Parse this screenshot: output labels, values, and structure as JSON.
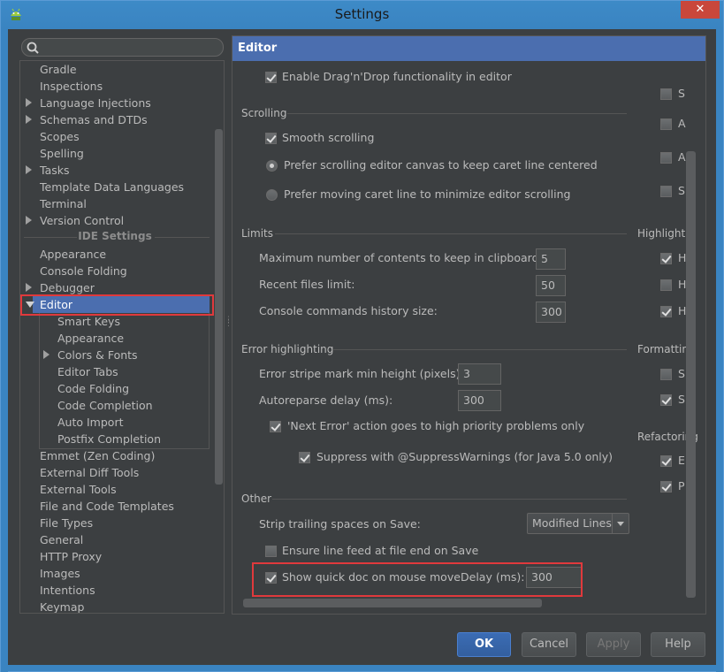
{
  "window": {
    "title": "Settings",
    "close_glyph": "✕"
  },
  "search": {
    "placeholder": ""
  },
  "tree": {
    "items_top": [
      {
        "label": "Gradle",
        "arrow": false
      },
      {
        "label": "Inspections",
        "arrow": false
      },
      {
        "label": "Language Injections",
        "arrow": true
      },
      {
        "label": "Schemas and DTDs",
        "arrow": true
      },
      {
        "label": "Scopes",
        "arrow": false
      },
      {
        "label": "Spelling",
        "arrow": false
      },
      {
        "label": "Tasks",
        "arrow": true
      },
      {
        "label": "Template Data Languages",
        "arrow": false
      },
      {
        "label": "Terminal",
        "arrow": false
      },
      {
        "label": "Version Control",
        "arrow": true
      }
    ],
    "section_label": "IDE Settings",
    "items_ide": [
      {
        "label": "Appearance",
        "arrow": false
      },
      {
        "label": "Console Folding",
        "arrow": false
      },
      {
        "label": "Debugger",
        "arrow": true
      }
    ],
    "selected": "Editor",
    "editor_children": [
      {
        "label": "Smart Keys",
        "arrow": false
      },
      {
        "label": "Appearance",
        "arrow": false
      },
      {
        "label": "Colors & Fonts",
        "arrow": true
      },
      {
        "label": "Editor Tabs",
        "arrow": false
      },
      {
        "label": "Code Folding",
        "arrow": false
      },
      {
        "label": "Code Completion",
        "arrow": false
      },
      {
        "label": "Auto Import",
        "arrow": false
      },
      {
        "label": "Postfix Completion",
        "arrow": false
      }
    ],
    "items_bottom": [
      {
        "label": "Emmet (Zen Coding)",
        "arrow": false
      },
      {
        "label": "External Diff Tools",
        "arrow": false
      },
      {
        "label": "External Tools",
        "arrow": false
      },
      {
        "label": "File and Code Templates",
        "arrow": false
      },
      {
        "label": "File Types",
        "arrow": false
      },
      {
        "label": "General",
        "arrow": false
      },
      {
        "label": "HTTP Proxy",
        "arrow": false
      },
      {
        "label": "Images",
        "arrow": false
      },
      {
        "label": "Intentions",
        "arrow": false
      },
      {
        "label": "Keymap",
        "arrow": false
      }
    ]
  },
  "panel": {
    "header": "Editor",
    "dragdrop": {
      "label": "Enable Drag'n'Drop functionality in editor",
      "checked": true
    },
    "scrolling": {
      "title": "Scrolling",
      "smooth": {
        "label": "Smooth scrolling",
        "checked": true
      },
      "radio1": {
        "label": "Prefer scrolling editor canvas to keep caret line centered",
        "selected": true
      },
      "radio2": {
        "label": "Prefer moving caret line to minimize editor scrolling",
        "selected": false
      }
    },
    "limits": {
      "title": "Limits",
      "clipboard": {
        "label": "Maximum number of contents to keep in clipboard:",
        "value": "5"
      },
      "recent": {
        "label": "Recent files limit:",
        "value": "50"
      },
      "console": {
        "label": "Console commands history size:",
        "value": "300"
      }
    },
    "error": {
      "title": "Error highlighting",
      "stripe": {
        "label": "Error stripe mark min height (pixels):",
        "value": "3"
      },
      "autoreparse": {
        "label": "Autoreparse delay (ms):",
        "value": "300"
      },
      "next_error": {
        "label": "'Next Error' action goes to high priority problems only",
        "checked": true
      },
      "suppress": {
        "label": "Suppress with @SuppressWarnings (for Java 5.0 only)",
        "checked": true
      }
    },
    "other": {
      "title": "Other",
      "strip": {
        "label": "Strip trailing spaces on Save:",
        "value": "Modified Lines"
      },
      "line_feed": {
        "label": "Ensure line feed at file end on Save",
        "checked": false
      },
      "quick_doc": {
        "label": "Show quick doc on mouse move",
        "checked": true,
        "delay_label": "Delay (ms):",
        "delay_value": "300"
      }
    },
    "right_column": {
      "top_checks": [
        {
          "label": "S",
          "checked": false
        },
        {
          "label": "A",
          "checked": false
        },
        {
          "label": "A",
          "checked": false
        },
        {
          "label": "S",
          "checked": false
        }
      ],
      "highlight": {
        "title": "Highlight",
        "checks": [
          {
            "label": "H",
            "checked": true
          },
          {
            "label": "H",
            "checked": false
          },
          {
            "label": "H",
            "checked": true
          }
        ]
      },
      "formatting": {
        "title": "Formatting",
        "checks": [
          {
            "label": "S",
            "checked": false
          },
          {
            "label": "S",
            "checked": true
          }
        ]
      },
      "refactoring": {
        "title": "Refactoring",
        "checks": [
          {
            "label": "E",
            "checked": true
          },
          {
            "label": "P",
            "checked": true
          }
        ]
      }
    }
  },
  "buttons": {
    "ok": "OK",
    "cancel": "Cancel",
    "apply": "Apply",
    "help": "Help"
  },
  "colors": {
    "background": "#3c3f41",
    "selection": "#4b6eaf",
    "titlebar": "#3a84c1",
    "highlight_box": "#e0393c"
  }
}
